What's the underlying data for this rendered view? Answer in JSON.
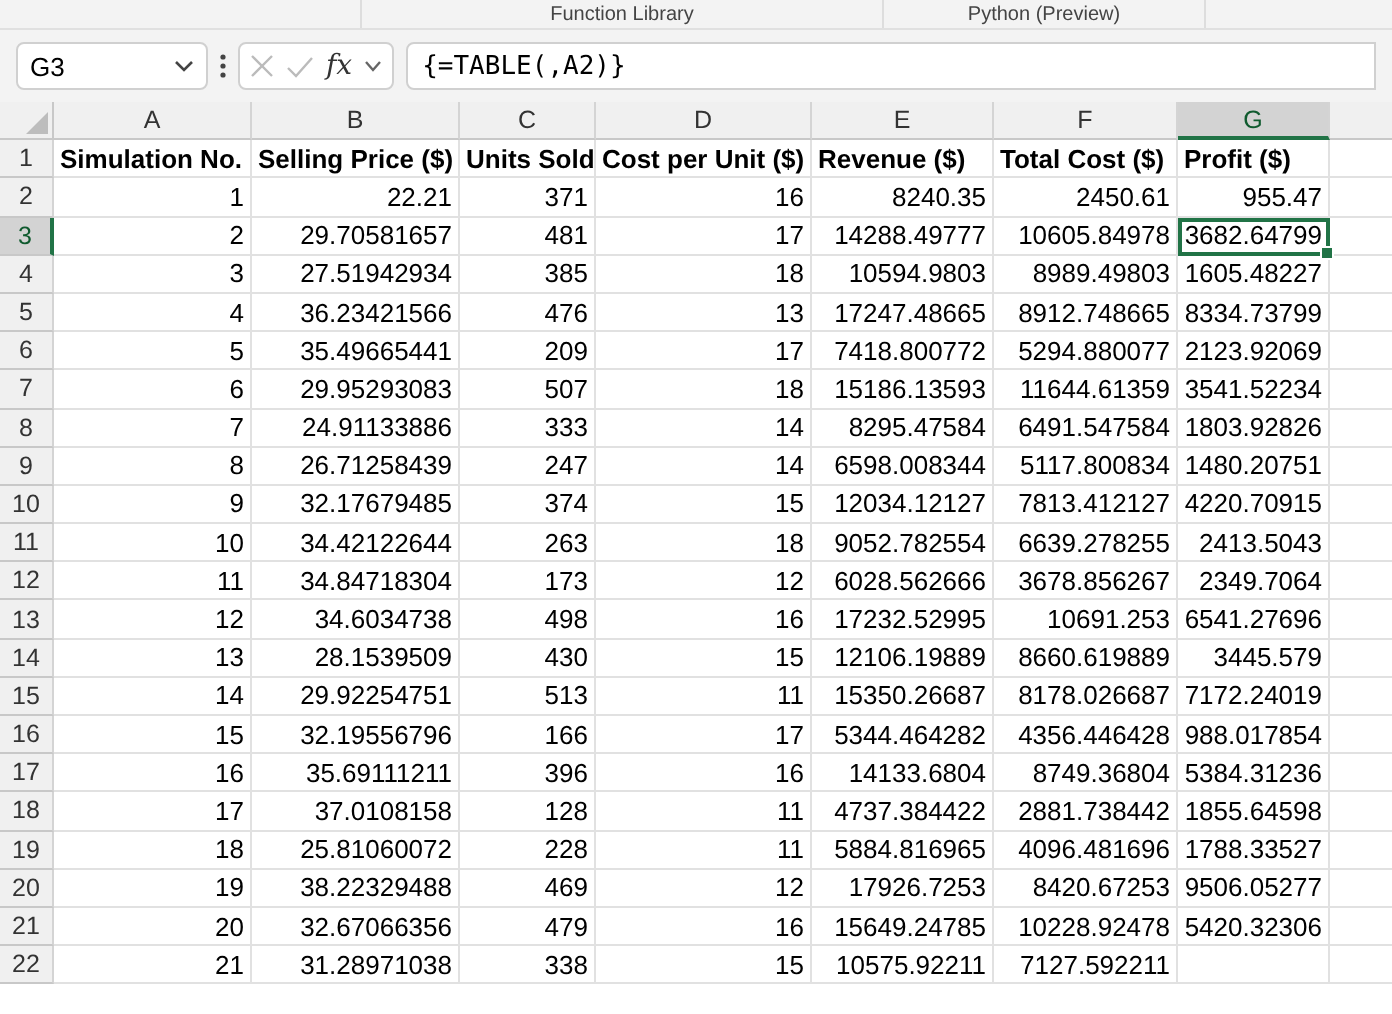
{
  "ribbon": {
    "groups": [
      "Function Library",
      "Python (Preview)"
    ]
  },
  "formula_bar": {
    "name_box": "G3",
    "function_label": "fx",
    "formula": "{=TABLE(,A2)}"
  },
  "table": {
    "columns": [
      {
        "label": "A",
        "selected": false
      },
      {
        "label": "B",
        "selected": false
      },
      {
        "label": "C",
        "selected": false
      },
      {
        "label": "D",
        "selected": false
      },
      {
        "label": "E",
        "selected": false
      },
      {
        "label": "F",
        "selected": false
      },
      {
        "label": "G",
        "selected": true
      }
    ],
    "rows": [
      {
        "label": "1",
        "selected": false,
        "kind": "header",
        "cells": [
          "Simulation No.",
          "Selling Price ($)",
          "Units Sold",
          "Cost per Unit ($)",
          "Revenue ($)",
          "Total Cost ($)",
          "Profit ($)"
        ]
      },
      {
        "label": "2",
        "selected": false,
        "kind": "data",
        "cells": [
          "1",
          "22.21",
          "371",
          "16",
          "8240.35",
          "2450.61",
          "955.47"
        ]
      },
      {
        "label": "3",
        "selected": true,
        "kind": "data",
        "cells": [
          "2",
          "29.70581657",
          "481",
          "17",
          "14288.49777",
          "10605.84978",
          "3682.64799"
        ]
      },
      {
        "label": "4",
        "selected": false,
        "kind": "data",
        "cells": [
          "3",
          "27.51942934",
          "385",
          "18",
          "10594.9803",
          "8989.49803",
          "1605.48227"
        ]
      },
      {
        "label": "5",
        "selected": false,
        "kind": "data",
        "cells": [
          "4",
          "36.23421566",
          "476",
          "13",
          "17247.48665",
          "8912.748665",
          "8334.73799"
        ]
      },
      {
        "label": "6",
        "selected": false,
        "kind": "data",
        "cells": [
          "5",
          "35.49665441",
          "209",
          "17",
          "7418.800772",
          "5294.880077",
          "2123.92069"
        ]
      },
      {
        "label": "7",
        "selected": false,
        "kind": "data",
        "cells": [
          "6",
          "29.95293083",
          "507",
          "18",
          "15186.13593",
          "11644.61359",
          "3541.52234"
        ]
      },
      {
        "label": "8",
        "selected": false,
        "kind": "data",
        "cells": [
          "7",
          "24.91133886",
          "333",
          "14",
          "8295.47584",
          "6491.547584",
          "1803.92826"
        ]
      },
      {
        "label": "9",
        "selected": false,
        "kind": "data",
        "cells": [
          "8",
          "26.71258439",
          "247",
          "14",
          "6598.008344",
          "5117.800834",
          "1480.20751"
        ]
      },
      {
        "label": "10",
        "selected": false,
        "kind": "data",
        "cells": [
          "9",
          "32.17679485",
          "374",
          "15",
          "12034.12127",
          "7813.412127",
          "4220.70915"
        ]
      },
      {
        "label": "11",
        "selected": false,
        "kind": "data",
        "cells": [
          "10",
          "34.42122644",
          "263",
          "18",
          "9052.782554",
          "6639.278255",
          "2413.5043"
        ]
      },
      {
        "label": "12",
        "selected": false,
        "kind": "data",
        "cells": [
          "11",
          "34.84718304",
          "173",
          "12",
          "6028.562666",
          "3678.856267",
          "2349.7064"
        ]
      },
      {
        "label": "13",
        "selected": false,
        "kind": "data",
        "cells": [
          "12",
          "34.6034738",
          "498",
          "16",
          "17232.52995",
          "10691.253",
          "6541.27696"
        ]
      },
      {
        "label": "14",
        "selected": false,
        "kind": "data",
        "cells": [
          "13",
          "28.1539509",
          "430",
          "15",
          "12106.19889",
          "8660.619889",
          "3445.579"
        ]
      },
      {
        "label": "15",
        "selected": false,
        "kind": "data",
        "cells": [
          "14",
          "29.92254751",
          "513",
          "11",
          "15350.26687",
          "8178.026687",
          "7172.24019"
        ]
      },
      {
        "label": "16",
        "selected": false,
        "kind": "data",
        "cells": [
          "15",
          "32.19556796",
          "166",
          "17",
          "5344.464282",
          "4356.446428",
          "988.017854"
        ]
      },
      {
        "label": "17",
        "selected": false,
        "kind": "data",
        "cells": [
          "16",
          "35.69111211",
          "396",
          "16",
          "14133.6804",
          "8749.36804",
          "5384.31236"
        ]
      },
      {
        "label": "18",
        "selected": false,
        "kind": "data",
        "cells": [
          "17",
          "37.0108158",
          "128",
          "11",
          "4737.384422",
          "2881.738442",
          "1855.64598"
        ]
      },
      {
        "label": "19",
        "selected": false,
        "kind": "data",
        "cells": [
          "18",
          "25.81060072",
          "228",
          "11",
          "5884.816965",
          "4096.481696",
          "1788.33527"
        ]
      },
      {
        "label": "20",
        "selected": false,
        "kind": "data",
        "cells": [
          "19",
          "38.22329488",
          "469",
          "12",
          "17926.7253",
          "8420.67253",
          "9506.05277"
        ]
      },
      {
        "label": "21",
        "selected": false,
        "kind": "data",
        "cells": [
          "20",
          "32.67066356",
          "479",
          "16",
          "15649.24785",
          "10228.92478",
          "5420.32306"
        ]
      },
      {
        "label": "22",
        "selected": false,
        "kind": "data",
        "cells": [
          "21",
          "31.28971038",
          "338",
          "15",
          "10575.92211",
          "7127.592211"
        ]
      }
    ]
  }
}
